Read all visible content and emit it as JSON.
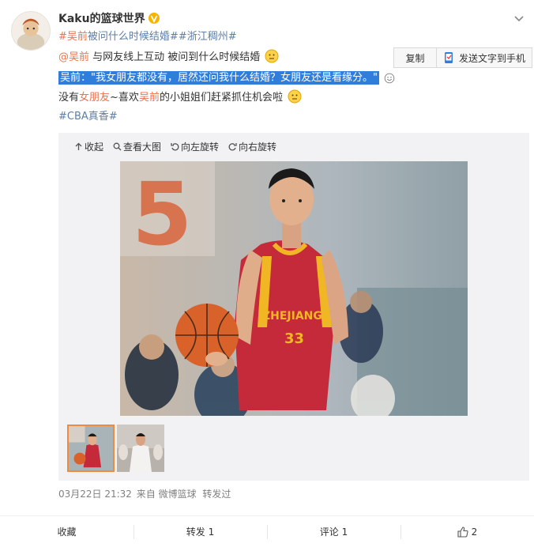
{
  "user": {
    "name": "Kaku的篮球世界"
  },
  "header_topics": {
    "topic1": "#吴前",
    "topic1_rest": "被问什么时候结婚#",
    "topic2": "#浙江稠州#"
  },
  "post": {
    "line1_mention": "@吴前",
    "line1_text": " 与网友线上互动 被问到什么时候结婚",
    "line2_highlight": "吴前：\"我女朋友都没有，居然还问我什么结婚？女朋友还是看缘分。\"",
    "line3_a": "没有",
    "line3_link": "女朋友",
    "line3_b": "~喜欢",
    "line3_link2": "吴前",
    "line3_c": "的小姐姐们赶紧抓住机会啦",
    "line4_topic": "#CBA真香#"
  },
  "copy_popup": {
    "copy_label": "复制",
    "send_label": "发送文字到手机"
  },
  "media_toolbar": {
    "collapse": "收起",
    "view_large": "查看大图",
    "rotate_left": "向左旋转",
    "rotate_right": "向右旋转"
  },
  "photo": {
    "jersey_text": "ZHEJIANG",
    "jersey_number": "33",
    "bg_number": "5"
  },
  "meta": {
    "date": "03月22日 21:32",
    "source": "来自 微博篮球",
    "reposted": "转发过"
  },
  "actions": {
    "favorite": "收藏",
    "repost": "转发 1",
    "comment": "评论 1",
    "like_count": "2"
  },
  "colors": {
    "highlight": "#2f7edc",
    "link_orange": "#eb7350",
    "topic_blue": "#5d7ea6",
    "verified": "#f7b500"
  }
}
